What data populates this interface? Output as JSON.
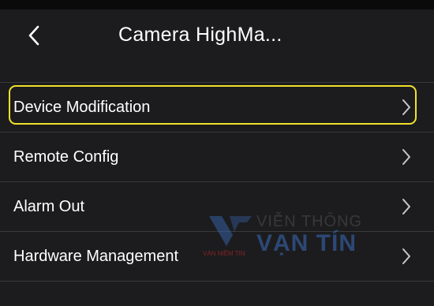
{
  "header": {
    "back_icon": "chevron-left-icon",
    "title": "Camera HighMa..."
  },
  "menu": {
    "items": [
      {
        "label": "Device Modification",
        "icon": "chevron-right-icon",
        "highlighted": true
      },
      {
        "label": "Remote Config",
        "icon": "chevron-right-icon"
      },
      {
        "label": "Alarm Out",
        "icon": "chevron-right-icon"
      },
      {
        "label": "Hardware Management",
        "icon": "chevron-right-icon"
      }
    ]
  },
  "watermark": {
    "line1": "VIỄN THÔNG",
    "line2": "VẠN TÍN",
    "tagline": "VẠN NIỀM TIN"
  },
  "colors": {
    "background": "#1c1c1e",
    "highlight": "#f2e12b",
    "divider": "#3a3a3c",
    "text": "#ffffff"
  }
}
